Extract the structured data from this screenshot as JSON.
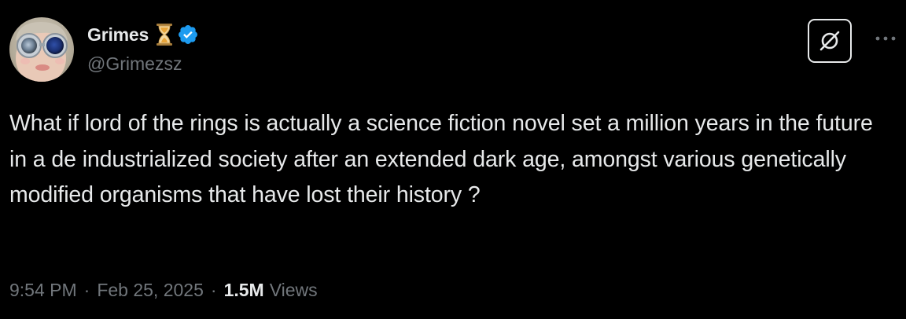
{
  "author": {
    "display_name": "Grimes",
    "handle": "@Grimezsz",
    "avatar_icon": "avatar-photo",
    "badge_icon": "hourglass-icon",
    "verified_icon": "verified-badge-icon",
    "verified_color": "#1d9bf0"
  },
  "tweet": {
    "text": "What if lord of the rings is actually a science fiction novel set a million years in the future in a de industrialized society after an extended dark age, amongst various genetically modified organisms that have lost their history ?"
  },
  "meta": {
    "time": "9:54 PM",
    "separator": "·",
    "date": "Feb 25, 2025",
    "views_count": "1.5M",
    "views_label": "Views"
  },
  "actions": {
    "grok_icon": "grok-icon",
    "more_icon": "more-horizontal-icon"
  },
  "colors": {
    "background": "#000000",
    "primary_text": "#e7e9ea",
    "secondary_text": "#71767b"
  }
}
